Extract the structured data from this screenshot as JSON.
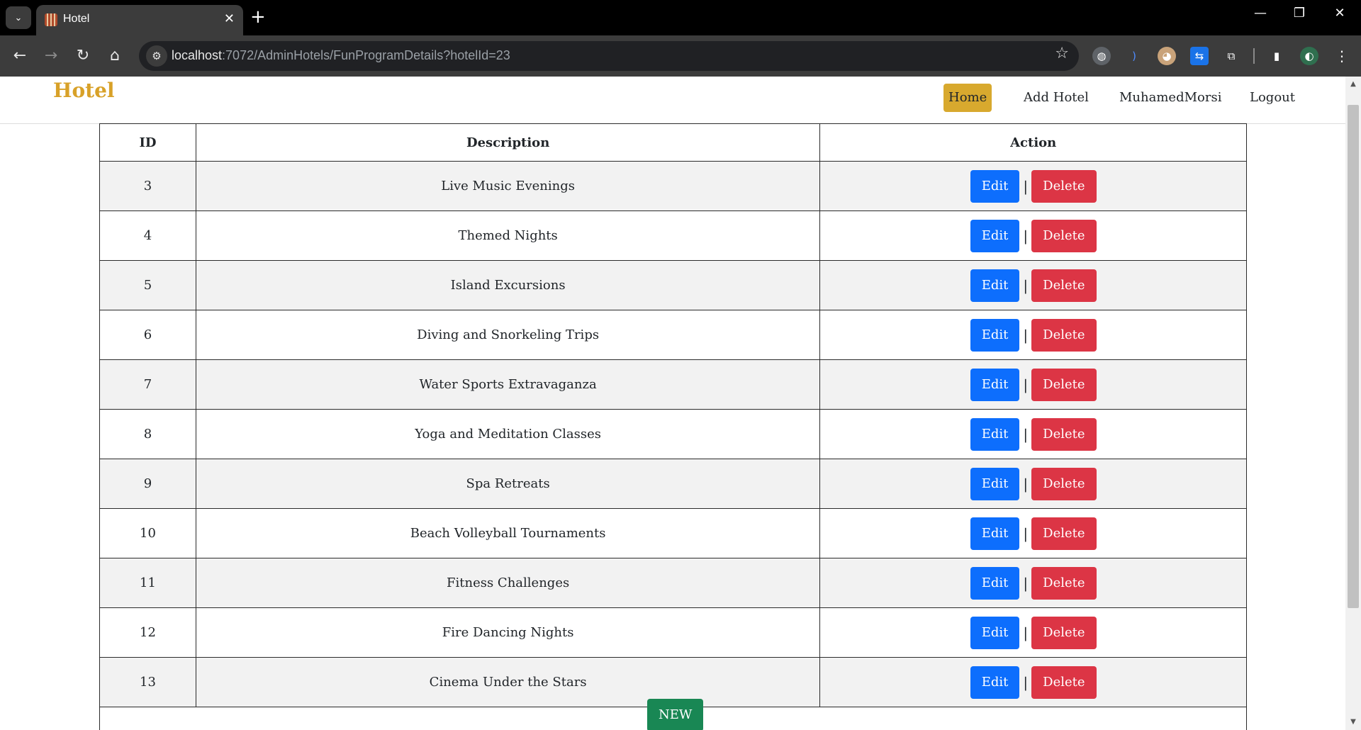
{
  "browser": {
    "tab_title": "Hotel",
    "url_host": "localhost",
    "url_rest": ":7072/AdminHotels/FunProgramDetails?hotelId=23",
    "icons": {
      "tab_search": "chevron-down-icon",
      "favicon": "hotel-favicon-icon",
      "close_tab": "close-icon",
      "new_tab": "plus-icon",
      "minimize": "minimize-icon",
      "restore": "restore-icon",
      "close_window": "close-icon",
      "back": "back-arrow-icon",
      "forward": "forward-arrow-icon",
      "reload": "reload-icon",
      "home": "home-icon",
      "site_info": "tune-icon",
      "bookmark": "star-icon",
      "menu": "kebab-menu-icon"
    },
    "glyphs": {
      "tab_search": "⌄",
      "close_tab": "✕",
      "new_tab": "+",
      "minimize": "—",
      "restore": "❐",
      "close_window": "✕",
      "back": "←",
      "forward": "→",
      "reload": "↻",
      "home": "⌂",
      "site_info": "⚙",
      "bookmark": "☆",
      "ext1": "◍",
      "ext2": ")",
      "ext3": "◕",
      "ext4": "⇆",
      "puzzle": "⧉",
      "sidebar": "▮",
      "profile": "◐",
      "menu": "⋮",
      "scroll_up": "▲",
      "scroll_down": "▼"
    }
  },
  "navbar": {
    "brand": "Hotel",
    "links": {
      "home": "Home",
      "add_hotel": "Add Hotel",
      "user": "MuhamedMorsi",
      "logout": "Logout"
    },
    "colors": {
      "brand": "#d8a128",
      "active_link_bg": "#d8a92e"
    }
  },
  "table": {
    "headers": {
      "id": "ID",
      "description": "Description",
      "action": "Action"
    },
    "rows": [
      {
        "id": "3",
        "description": "Live Music Evenings"
      },
      {
        "id": "4",
        "description": "Themed Nights"
      },
      {
        "id": "5",
        "description": "Island Excursions"
      },
      {
        "id": "6",
        "description": "Diving and Snorkeling Trips"
      },
      {
        "id": "7",
        "description": "Water Sports Extravaganza"
      },
      {
        "id": "8",
        "description": "Yoga and Meditation Classes"
      },
      {
        "id": "9",
        "description": "Spa Retreats"
      },
      {
        "id": "10",
        "description": "Beach Volleyball Tournaments"
      },
      {
        "id": "11",
        "description": "Fitness Challenges"
      },
      {
        "id": "12",
        "description": "Fire Dancing Nights"
      },
      {
        "id": "13",
        "description": "Cinema Under the Stars"
      }
    ],
    "edit_label": "Edit",
    "delete_label": "Delete",
    "separator": "|",
    "colors": {
      "edit": "#0d6efd",
      "delete": "#dc3545"
    }
  },
  "new_button": {
    "label": "NEW",
    "color": "#198754"
  }
}
